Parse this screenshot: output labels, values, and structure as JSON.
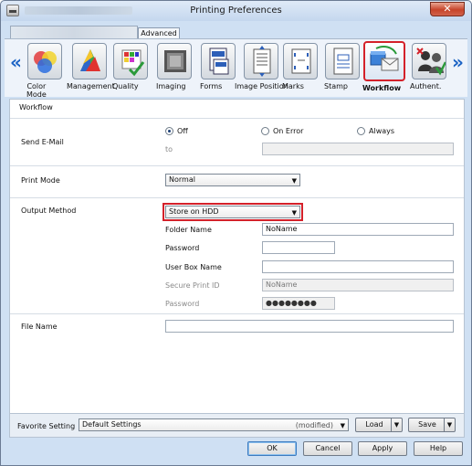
{
  "window": {
    "title": "Printing Preferences",
    "close_glyph": "✕"
  },
  "tabs": [
    {
      "label": "Advanced"
    }
  ],
  "toolbar": {
    "left_arrow": "«",
    "right_arrow": "»",
    "items": [
      {
        "label": "Color\nMode",
        "icon": "color-mode-icon"
      },
      {
        "label": "Management",
        "icon": "management-icon"
      },
      {
        "label": "Quality",
        "icon": "quality-icon"
      },
      {
        "label": "Imaging",
        "icon": "imaging-icon"
      },
      {
        "label": "Forms",
        "icon": "forms-icon"
      },
      {
        "label": "Image Position",
        "icon": "image-position-icon"
      },
      {
        "label": "Marks",
        "icon": "marks-icon"
      },
      {
        "label": "Stamp",
        "icon": "stamp-icon"
      },
      {
        "label": "Workflow",
        "icon": "workflow-icon",
        "selected": true
      },
      {
        "label": "Authent.",
        "icon": "authentication-icon"
      }
    ]
  },
  "workflow": {
    "heading": "Workflow",
    "send_email": {
      "label": "Send E-Mail",
      "options": [
        "Off",
        "On Error",
        "Always"
      ],
      "selected": "Off",
      "to_label": "to",
      "to_value": ""
    },
    "print_mode": {
      "label": "Print Mode",
      "value": "Normal"
    },
    "output_method": {
      "label": "Output Method",
      "value": "Store on HDD",
      "folder_name_label": "Folder Name",
      "folder_name_value": "NoName",
      "password_label": "Password",
      "password_value": "",
      "user_box_label": "User Box Name",
      "user_box_value": "",
      "secure_id_label": "Secure Print ID",
      "secure_id_value": "NoName",
      "secure_password_label": "Password",
      "secure_password_value": "●●●●●●●●"
    },
    "file_name": {
      "label": "File Name",
      "value": ""
    }
  },
  "footer": {
    "favorite_label": "Favorite Setting",
    "favorite_value": "Default Settings",
    "favorite_state": "(modified)",
    "load_label": "Load",
    "save_label": "Save"
  },
  "buttons": {
    "ok": "OK",
    "cancel": "Cancel",
    "apply": "Apply",
    "help": "Help"
  },
  "colors": {
    "accent_red": "#d4212a",
    "window_blue": "#cfe0f3"
  }
}
